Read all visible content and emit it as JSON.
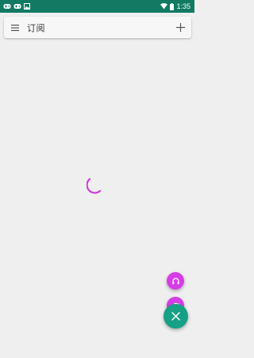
{
  "status_bar": {
    "time": "1:35",
    "icons_left": [
      "gamepad-icon",
      "gamepad-icon",
      "image-icon"
    ],
    "icons_right": [
      "wifi-icon",
      "battery-icon"
    ],
    "background": "#127a63"
  },
  "toolbar": {
    "title": "订阅",
    "menu_icon": "hamburger-menu-icon",
    "add_icon": "plus-icon"
  },
  "content": {
    "loading_indicator": "spinner"
  },
  "fabs": {
    "headset_icon": "headset-icon",
    "refresh_icon": "refresh-icon",
    "close_icon": "close-icon",
    "small_color": "#d63de6",
    "main_color": "#16a085"
  }
}
